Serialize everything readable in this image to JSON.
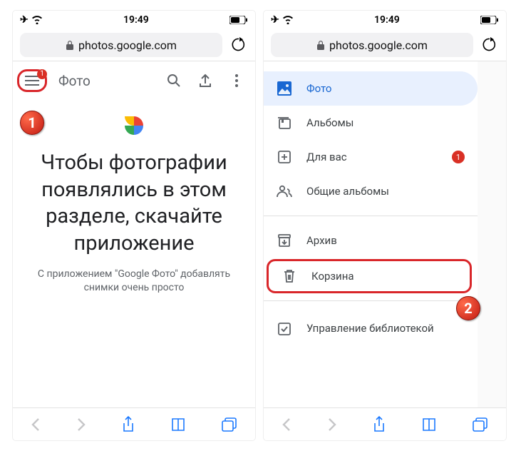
{
  "status": {
    "time": "19:49"
  },
  "url": "photos.google.com",
  "left": {
    "hamburger_badge": "1",
    "title": "Фото",
    "heading": "Чтобы фотографии появлялись в этом разделе, скачайте приложение",
    "sub": "С приложением \"Google Фото\" добавлять снимки очень просто"
  },
  "drawer": {
    "photos": "Фото",
    "albums": "Альбомы",
    "for_you": "Для вас",
    "for_you_badge": "1",
    "shared": "Общие альбомы",
    "archive": "Архив",
    "trash": "Корзина",
    "manage": "Управление библиотекой"
  },
  "callout": {
    "n1": "1",
    "n2": "2"
  }
}
